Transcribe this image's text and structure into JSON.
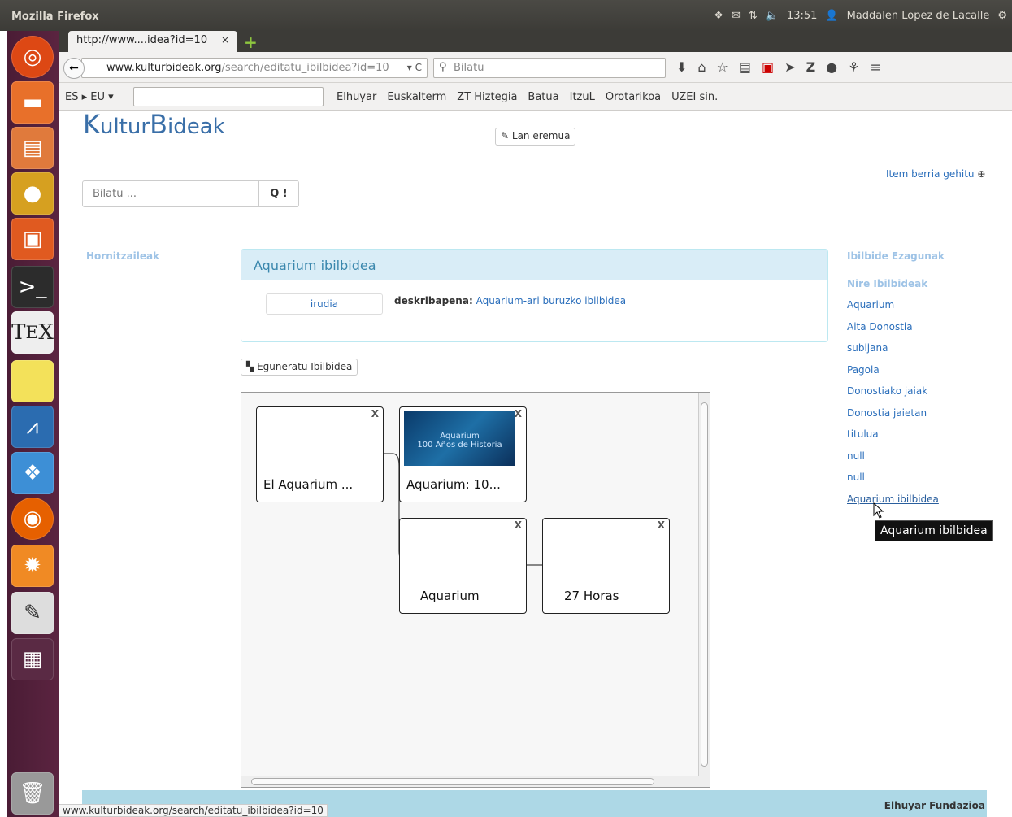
{
  "top_panel": {
    "title": "Mozilla Firefox",
    "time": "13:51",
    "user": "Maddalen Lopez de Lacalle"
  },
  "tab": {
    "title": "http://www....idea?id=10",
    "close": "×",
    "new_tab": "+"
  },
  "nav": {
    "back": "←",
    "url_domain": "www.kulturbideak.org",
    "url_path": "/search/editatu_ibilbidea?id=10",
    "url_controls": "▾ C",
    "search_placeholder": "Bilatu",
    "icons": [
      "download-icon",
      "home-icon",
      "star-icon",
      "clipboard-icon",
      "pdf-icon",
      "send-icon",
      "zotero-icon",
      "chat-icon",
      "extension-icon",
      "menu-icon"
    ]
  },
  "toolbar": {
    "lang": "ES ▸ EU ▾",
    "links": [
      "Elhuyar",
      "Euskalterm",
      "ZT Hiztegia",
      "Batua",
      "ItzuL",
      "Orotarikoa",
      "UZEI sin."
    ]
  },
  "page": {
    "logo_k": "K",
    "logo_ultur": "ultur",
    "logo_b": "B",
    "logo_ideak": "ideak",
    "lan_eremua": "Lan eremua",
    "search_placeholder": "Bilatu ...",
    "search_button": "Q !",
    "add_item": "Item berria gehitu",
    "providers": "Hornitzaileak",
    "panel_title": "Aquarium ibilbidea",
    "irudia": "irudia",
    "desc_label": "deskribapena:",
    "desc_value": "Aquarium-ari buruzko ibilbidea",
    "update_button": "Eguneratu Ibilbidea",
    "nodes": [
      {
        "label": "El Aquarium ...",
        "close": "X"
      },
      {
        "label": "Aquarium: 10...",
        "close": "X",
        "thumb_line1": "Aquarium",
        "thumb_line2": "100 Años de Historia"
      },
      {
        "label": "Aquarium",
        "close": "X"
      },
      {
        "label": "27 Horas",
        "close": "X"
      }
    ],
    "sidebar_heading": "Ibilbide Ezagunak",
    "sidebar_subheading": "Nire Ibilbideak",
    "sidebar_items": [
      "Aquarium",
      "Aita Donostia",
      "subijana",
      "Pagola",
      "Donostiako jaiak",
      "Donostia jaietan",
      "titulua",
      "null",
      "null",
      "Aquarium ibilbidea"
    ],
    "tooltip": "Aquarium ibilbidea",
    "footer": "Elhuyar Fundazioa"
  },
  "status_url": "www.kulturbideak.org/search/editatu_ibilbidea?id=10"
}
